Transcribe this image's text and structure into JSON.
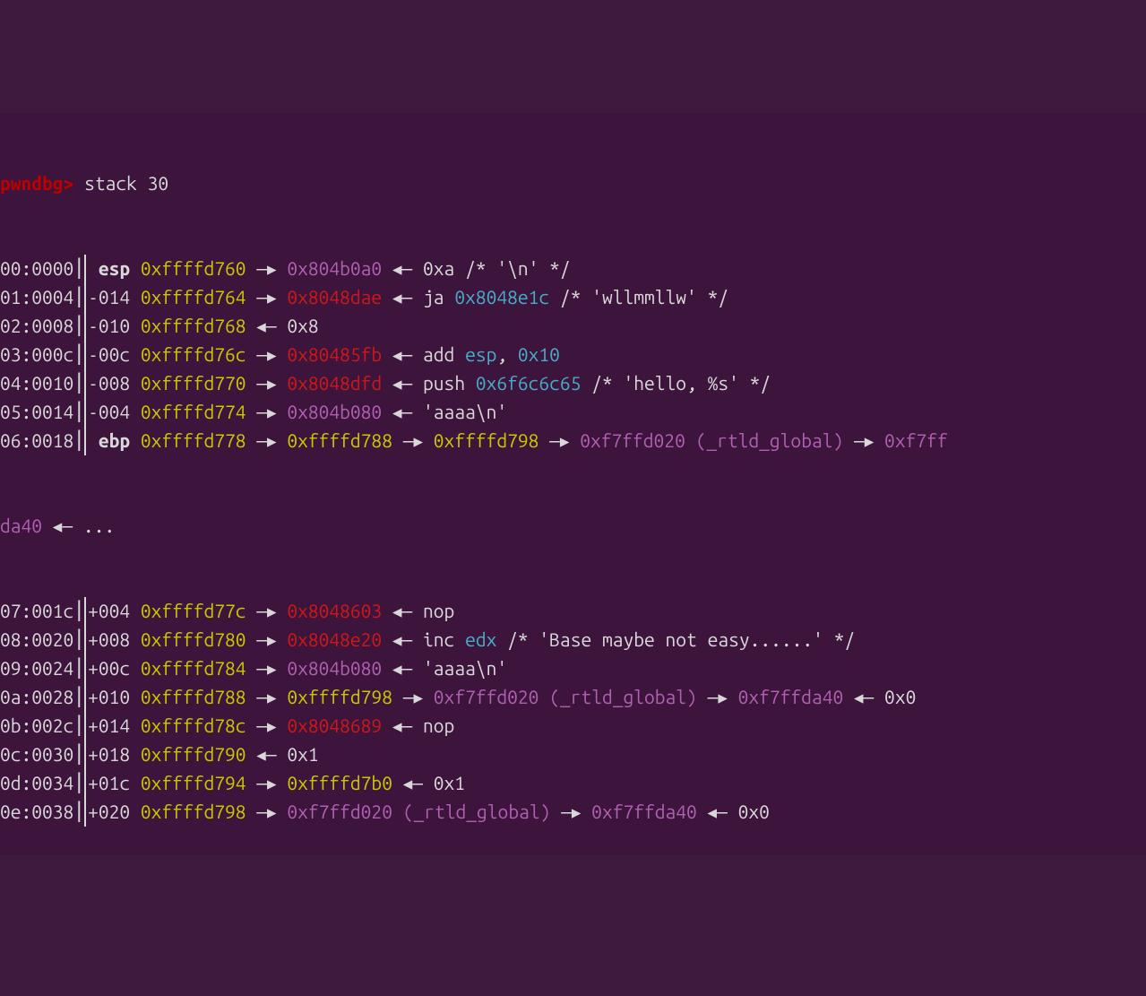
{
  "prompt": "pwndbg>",
  "command": "stack 30",
  "rows": [
    {
      "offset": "00:0000",
      "reg": " esp ",
      "addr": "0xffffd760",
      "chain": [
        {
          "type": "arrow",
          "val": "—▸"
        },
        {
          "type": "purple",
          "val": " 0x804b0a0 "
        },
        {
          "type": "larrow",
          "val": "◂—"
        },
        {
          "type": "str",
          "val": " 0xa /* '\\n' */"
        }
      ]
    },
    {
      "offset": "01:0004",
      "rel": "-014 ",
      "addr": "0xffffd764",
      "chain": [
        {
          "type": "arrow",
          "val": "—▸"
        },
        {
          "type": "red",
          "val": " 0x8048dae "
        },
        {
          "type": "larrow",
          "val": "◂—"
        },
        {
          "type": "instr",
          "val": " ja "
        },
        {
          "type": "cyan",
          "val": "0x8048e1c"
        },
        {
          "type": "str",
          "val": " /* 'wllmmllw' */"
        }
      ]
    },
    {
      "offset": "02:0008",
      "rel": "-010 ",
      "addr": "0xffffd768",
      "chain": [
        {
          "type": "larrow",
          "val": "◂—"
        },
        {
          "type": "str",
          "val": " 0x8"
        }
      ]
    },
    {
      "offset": "03:000c",
      "rel": "-00c ",
      "addr": "0xffffd76c",
      "chain": [
        {
          "type": "arrow",
          "val": "—▸"
        },
        {
          "type": "red",
          "val": " 0x80485fb "
        },
        {
          "type": "larrow",
          "val": "◂—"
        },
        {
          "type": "instr",
          "val": " add "
        },
        {
          "type": "reg-cyan",
          "val": "esp"
        },
        {
          "type": "comma",
          "val": ", "
        },
        {
          "type": "cyan",
          "val": "0x10"
        }
      ]
    },
    {
      "offset": "04:0010",
      "rel": "-008 ",
      "addr": "0xffffd770",
      "chain": [
        {
          "type": "arrow",
          "val": "—▸"
        },
        {
          "type": "red",
          "val": " 0x8048dfd "
        },
        {
          "type": "larrow",
          "val": "◂—"
        },
        {
          "type": "instr",
          "val": " push "
        },
        {
          "type": "cyan",
          "val": "0x6f6c6c65"
        },
        {
          "type": "str",
          "val": " /* 'hello, %s' */"
        }
      ]
    },
    {
      "offset": "05:0014",
      "rel": "-004 ",
      "addr": "0xffffd774",
      "chain": [
        {
          "type": "arrow",
          "val": "—▸"
        },
        {
          "type": "purple",
          "val": " 0x804b080 "
        },
        {
          "type": "larrow",
          "val": "◂—"
        },
        {
          "type": "str",
          "val": " 'aaaa\\n'"
        }
      ]
    },
    {
      "offset": "06:0018",
      "reg": " ebp ",
      "addr": "0xffffd778",
      "chain": [
        {
          "type": "arrow",
          "val": "—▸"
        },
        {
          "type": "yellow",
          "val": " 0xffffd788 "
        },
        {
          "type": "arrow",
          "val": "—▸"
        },
        {
          "type": "yellow",
          "val": " 0xffffd798 "
        },
        {
          "type": "arrow",
          "val": "—▸"
        },
        {
          "type": "purple",
          "val": " 0xf7ffd020 "
        },
        {
          "type": "paren",
          "val": "(_rtld_global)"
        },
        {
          "type": "arrow",
          "val": " —▸"
        },
        {
          "type": "purple",
          "val": " 0xf7ff"
        }
      ]
    }
  ],
  "continuation": {
    "addr": "da40",
    "larrow": " ◂—",
    "ellipsis": " ..."
  },
  "rows2": [
    {
      "offset": "07:001c",
      "rel": "+004 ",
      "addr": "0xffffd77c",
      "chain": [
        {
          "type": "arrow",
          "val": "—▸"
        },
        {
          "type": "red",
          "val": " 0x8048603 "
        },
        {
          "type": "larrow",
          "val": "◂—"
        },
        {
          "type": "instr",
          "val": " nop "
        }
      ]
    },
    {
      "offset": "08:0020",
      "rel": "+008 ",
      "addr": "0xffffd780",
      "chain": [
        {
          "type": "arrow",
          "val": "—▸"
        },
        {
          "type": "red",
          "val": " 0x8048e20 "
        },
        {
          "type": "larrow",
          "val": "◂—"
        },
        {
          "type": "instr",
          "val": " inc "
        },
        {
          "type": "reg-cyan",
          "val": "edx"
        },
        {
          "type": "str",
          "val": " /* 'Base maybe not easy......' */"
        }
      ]
    },
    {
      "offset": "09:0024",
      "rel": "+00c ",
      "addr": "0xffffd784",
      "chain": [
        {
          "type": "arrow",
          "val": "—▸"
        },
        {
          "type": "purple",
          "val": " 0x804b080 "
        },
        {
          "type": "larrow",
          "val": "◂—"
        },
        {
          "type": "str",
          "val": " 'aaaa\\n'"
        }
      ]
    },
    {
      "offset": "0a:0028",
      "rel": "+010 ",
      "addr": "0xffffd788",
      "chain": [
        {
          "type": "arrow",
          "val": "—▸"
        },
        {
          "type": "yellow",
          "val": " 0xffffd798 "
        },
        {
          "type": "arrow",
          "val": "—▸"
        },
        {
          "type": "purple",
          "val": " 0xf7ffd020 "
        },
        {
          "type": "paren",
          "val": "(_rtld_global)"
        },
        {
          "type": "arrow",
          "val": " —▸"
        },
        {
          "type": "purple",
          "val": " 0xf7ffda40 "
        },
        {
          "type": "larrow",
          "val": "◂—"
        },
        {
          "type": "str",
          "val": " 0x0"
        }
      ]
    },
    {
      "offset": "0b:002c",
      "rel": "+014 ",
      "addr": "0xffffd78c",
      "chain": [
        {
          "type": "arrow",
          "val": "—▸"
        },
        {
          "type": "red",
          "val": " 0x8048689 "
        },
        {
          "type": "larrow",
          "val": "◂—"
        },
        {
          "type": "instr",
          "val": " nop "
        }
      ]
    },
    {
      "offset": "0c:0030",
      "rel": "+018 ",
      "addr": "0xffffd790",
      "chain": [
        {
          "type": "larrow",
          "val": "◂—"
        },
        {
          "type": "str",
          "val": " 0x1"
        }
      ]
    },
    {
      "offset": "0d:0034",
      "rel": "+01c ",
      "addr": "0xffffd794",
      "chain": [
        {
          "type": "arrow",
          "val": "—▸"
        },
        {
          "type": "yellow",
          "val": " 0xffffd7b0 "
        },
        {
          "type": "larrow",
          "val": "◂—"
        },
        {
          "type": "str",
          "val": " 0x1"
        }
      ]
    },
    {
      "offset": "0e:0038",
      "rel": "+020 ",
      "addr": "0xffffd798",
      "chain": [
        {
          "type": "arrow",
          "val": "—▸"
        },
        {
          "type": "purple",
          "val": " 0xf7ffd020 "
        },
        {
          "type": "paren",
          "val": "(_rtld_global)"
        },
        {
          "type": "arrow",
          "val": " —▸"
        },
        {
          "type": "purple",
          "val": " 0xf7ffda40 "
        },
        {
          "type": "larrow",
          "val": "◂—"
        },
        {
          "type": "str",
          "val": " 0x0"
        }
      ]
    }
  ]
}
